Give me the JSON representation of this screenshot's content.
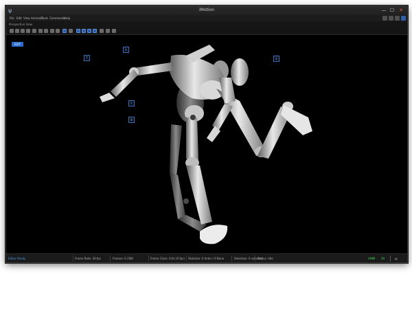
{
  "window": {
    "title": "iMotion"
  },
  "menu": {
    "items": [
      "File",
      "Edit",
      "View",
      "Animate",
      "Tools",
      "Commands",
      "Help"
    ]
  },
  "view": {
    "title": "Perspective View",
    "mode_button": "EDIT",
    "markers": [
      "T",
      "h",
      "S",
      "F",
      "B"
    ]
  },
  "status": {
    "ready": "Editor Ready",
    "fields": [
      "Frame Rate: 30 fps",
      "Frames: 0 /300",
      "Frame Clock: 0.0s (0 fps)",
      "Skeleton: 0 Actor / 0 Bone",
      "Selection: 0 selected",
      "Status: Idle"
    ],
    "indicator": "ANIM",
    "counter": "30"
  }
}
